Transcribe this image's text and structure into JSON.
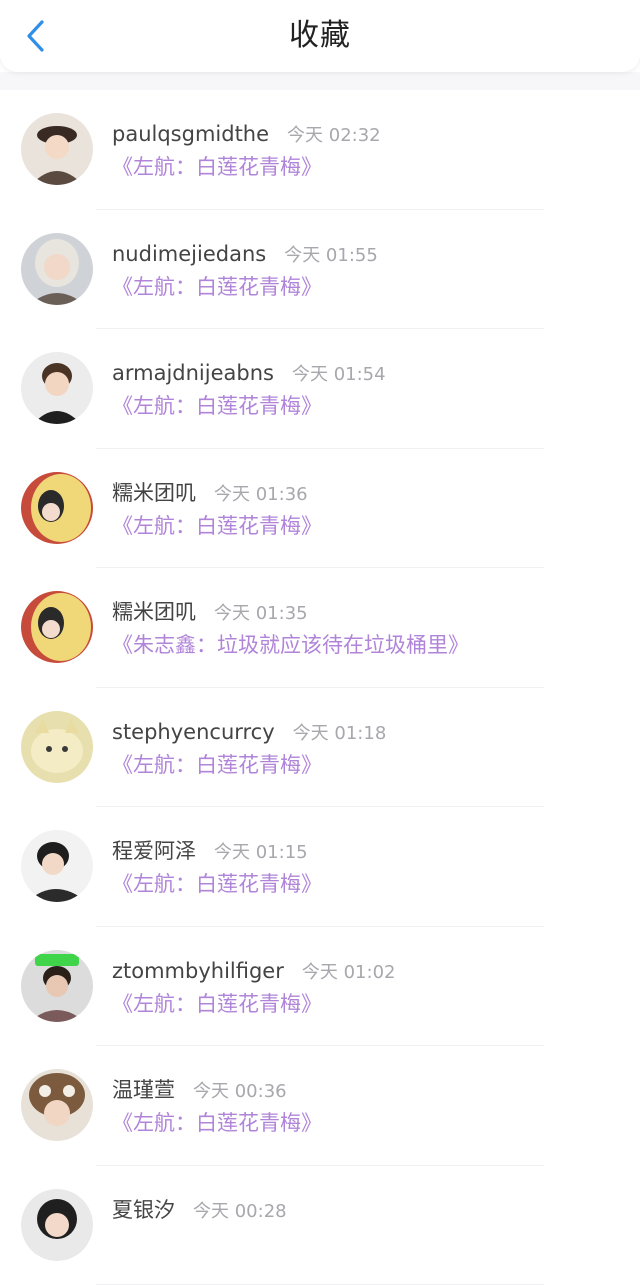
{
  "header": {
    "title": "收藏",
    "accent": "#2f8ee8"
  },
  "items": [
    {
      "name": "paulqsgmidthe",
      "time": "今天 02:32",
      "text": "《左航：白莲花青梅》"
    },
    {
      "name": "nudimejiedans",
      "time": "今天 01:55",
      "text": "《左航：白莲花青梅》"
    },
    {
      "name": "armajdnijeabns",
      "time": "今天 01:54",
      "text": "《左航：白莲花青梅》"
    },
    {
      "name": "糯米团叽",
      "time": "今天 01:36",
      "text": "《左航：白莲花青梅》"
    },
    {
      "name": "糯米团叽",
      "time": "今天 01:35",
      "text": "《朱志鑫：垃圾就应该待在垃圾桶里》"
    },
    {
      "name": "stephyencurrcy",
      "time": "今天 01:18",
      "text": "《左航：白莲花青梅》"
    },
    {
      "name": "程爱阿泽",
      "time": "今天 01:15",
      "text": "《左航：白莲花青梅》"
    },
    {
      "name": "ztommbyhilfiger",
      "time": "今天 01:02",
      "text": "《左航：白莲花青梅》"
    },
    {
      "name": "温瑾萱",
      "time": "今天 00:36",
      "text": "《左航：白莲花青梅》"
    },
    {
      "name": "夏银汐",
      "time": "今天 00:28",
      "text": ""
    }
  ],
  "colors": {
    "title_purple": "#b084d9",
    "time_gray": "#a7a7ad"
  }
}
